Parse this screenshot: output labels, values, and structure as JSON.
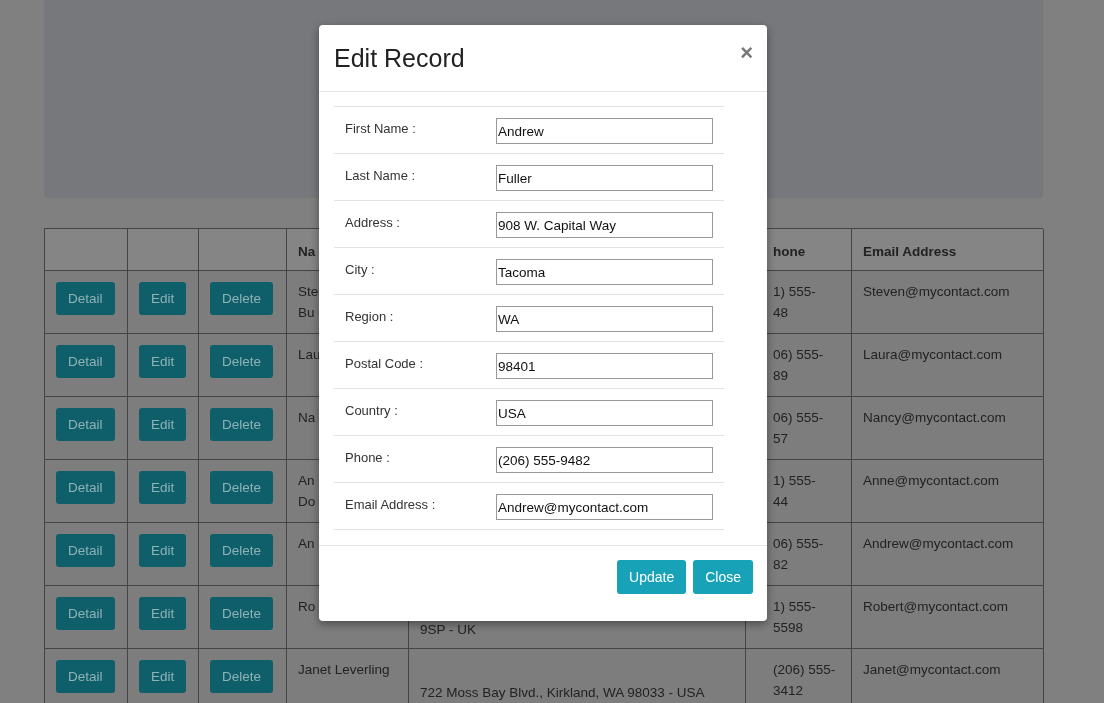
{
  "table": {
    "header": {
      "column_4": "Na",
      "column_6": "hone",
      "column_7": "Email Address"
    },
    "rows": [
      {
        "actions": [
          "Detail",
          "Edit",
          "Delete"
        ],
        "column_4": "Ste\nBu",
        "column_6": "1) 555-\n48",
        "column_7": "Steven@mycontact.com"
      },
      {
        "actions": [
          "Detail",
          "Edit",
          "Delete"
        ],
        "column_4": "Lau",
        "column_6": "06) 555-\n89",
        "column_7": "Laura@mycontact.com"
      },
      {
        "actions": [
          "Detail",
          "Edit",
          "Delete"
        ],
        "column_4": "Na",
        "column_6": "06) 555-\n57",
        "column_7": "Nancy@mycontact.com"
      },
      {
        "actions": [
          "Detail",
          "Edit",
          "Delete"
        ],
        "column_4": "An\nDo",
        "column_6": "1) 555-\n44",
        "column_7": "Anne@mycontact.com"
      },
      {
        "actions": [
          "Detail",
          "Edit",
          "Delete"
        ],
        "column_4": "An",
        "column_6": "06) 555-\n82",
        "column_7": "Andrew@mycontact.com"
      },
      {
        "actions": [
          "Detail",
          "Edit",
          "Delete"
        ],
        "column_4": "Ro",
        "column_5": "9SP - UK",
        "column_6": "1) 555-\n5598",
        "column_7": "Robert@mycontact.com"
      },
      {
        "actions": [
          "Detail",
          "Edit",
          "Delete"
        ],
        "column_4": "Janet Leverling",
        "column_5": "722 Moss Bay Blvd., Kirkland, WA 98033 - USA",
        "column_6": "(206) 555-\n3412",
        "column_7": "Janet@mycontact.com"
      }
    ]
  },
  "modal": {
    "title": "Edit Record",
    "close": "×",
    "fields": [
      {
        "label": "First Name :",
        "value": "Andrew"
      },
      {
        "label": "Last Name :",
        "value": "Fuller"
      },
      {
        "label": "Address :",
        "value": "908 W. Capital Way"
      },
      {
        "label": "City :",
        "value": "Tacoma"
      },
      {
        "label": "Region :",
        "value": "WA"
      },
      {
        "label": "Postal Code :",
        "value": "98401"
      },
      {
        "label": "Country :",
        "value": "USA"
      },
      {
        "label": "Phone :",
        "value": "(206) 555-9482"
      },
      {
        "label": "Email Address :",
        "value": "Andrew@mycontact.com"
      }
    ],
    "buttons": [
      "Update",
      "Close"
    ]
  }
}
